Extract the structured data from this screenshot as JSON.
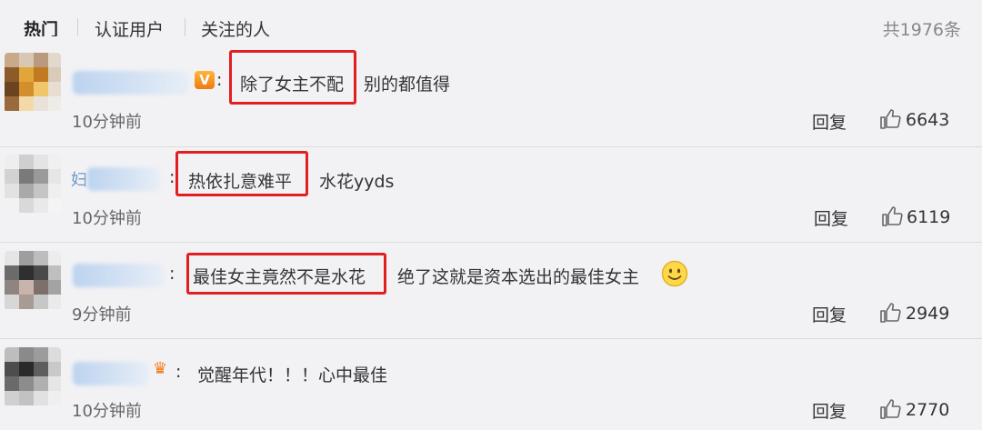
{
  "tabs": [
    {
      "label": "热门",
      "active": true
    },
    {
      "label": "认证用户",
      "active": false
    },
    {
      "label": "关注的人",
      "active": false
    }
  ],
  "total_count": "共1976条",
  "comments": [
    {
      "user_badge": "V",
      "highlight": "除了女主不配",
      "rest": "别的都值得",
      "time": "10分钟前",
      "reply_label": "回复",
      "likes": "6643"
    },
    {
      "name_first_char": "妇",
      "highlight": "热依扎意难平",
      "rest": "水花yyds",
      "time": "10分钟前",
      "reply_label": "回复",
      "likes": "6119"
    },
    {
      "highlight": "最佳女主竟然不是水花",
      "rest": "绝了这就是资本选出的最佳女主",
      "emoji": "smiley-icon",
      "time": "9分钟前",
      "reply_label": "回复",
      "likes": "2949"
    },
    {
      "user_badge": "crown",
      "text": "觉醒年代！！！心中最佳",
      "time": "10分钟前",
      "reply_label": "回复",
      "likes": "2770"
    }
  ],
  "colors": {
    "background": "#f2f2f5",
    "highlight_border": "#e02020",
    "username_blue": "#6f97c9",
    "vip_orange": "#f39a1e"
  }
}
